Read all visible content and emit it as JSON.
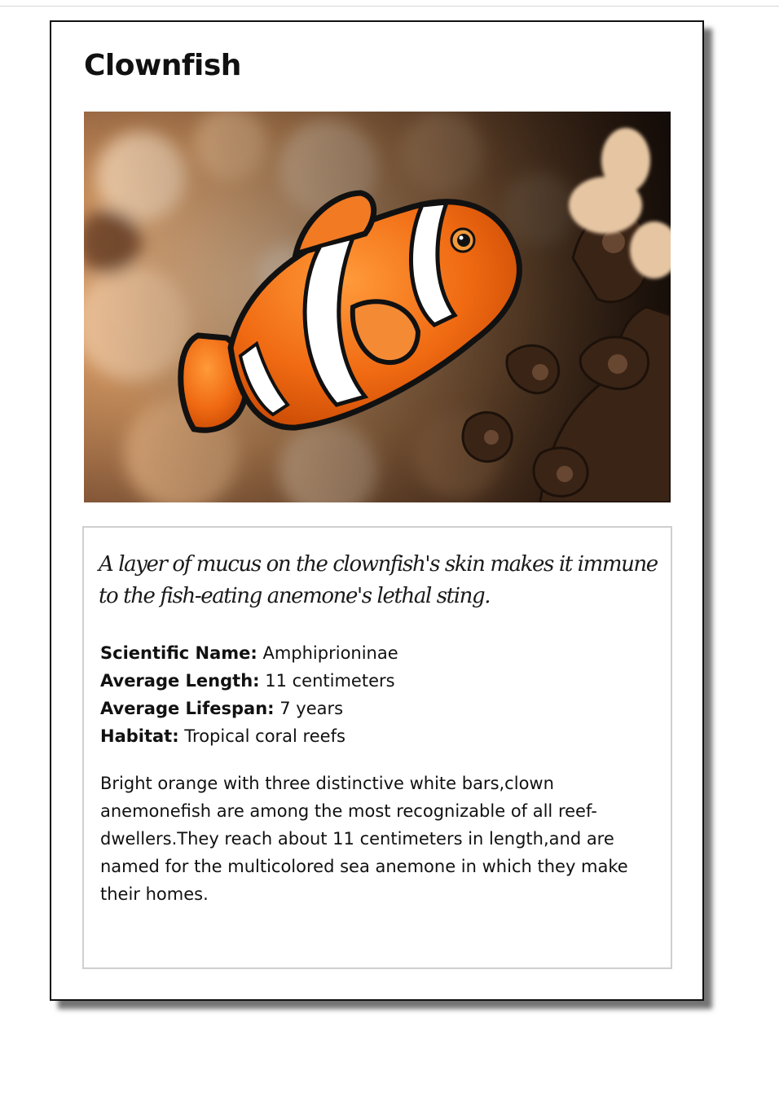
{
  "card": {
    "title": "Clownfish",
    "image_alt": "clownfish-photo",
    "fun_fact": "A layer of mucus on the clownfish's skin makes it immune to the fish-eating anemone's lethal sting.",
    "facts": [
      {
        "label": "Scientific Name:",
        "value": " Amphiprioninae"
      },
      {
        "label": "Average Length:",
        "value": " 11 centimeters"
      },
      {
        "label": "Average Lifespan:",
        "value": " 7 years"
      },
      {
        "label": "Habitat:",
        "value": " Tropical coral reefs"
      }
    ],
    "description": "Bright orange with three distinctive white bars,clown anemonefish are among the most recognizable of all reef-dwellers.They reach about 11 centimeters in length,and are named for the multicolored sea anemone in which they make their homes."
  },
  "colors": {
    "fish_orange": "#f06a12",
    "stripe_white": "#ffffff",
    "outline_black": "#111111",
    "background_tan": "#d9a779"
  }
}
